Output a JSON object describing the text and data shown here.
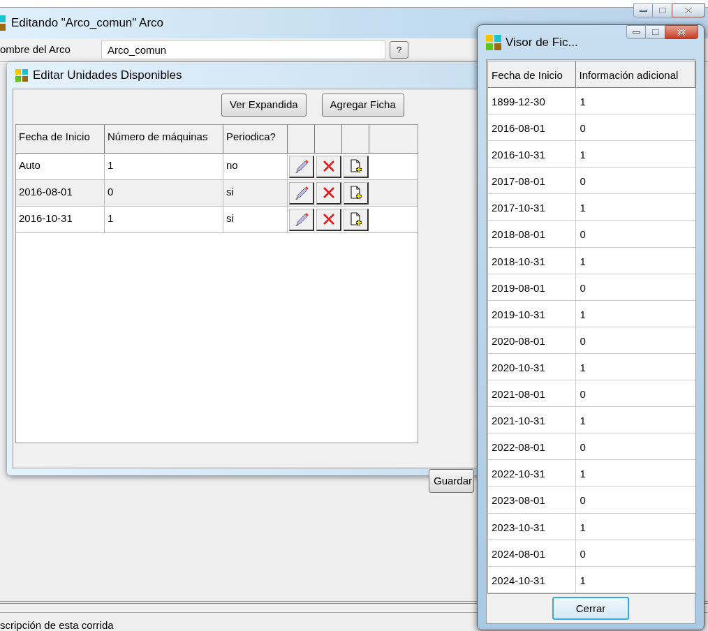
{
  "main_window": {
    "title": "Editando \"Arco_comun\" Arco",
    "name_label": "ombre del Arco",
    "name_value": "Arco_comun",
    "help_button": "?",
    "status_text": "scripción de esta corrida"
  },
  "units_dialog": {
    "title": "Editar Unidades Disponibles",
    "buttons": [
      "Ver Expandida",
      "Agregar Ficha"
    ],
    "columns": [
      "Fecha de Inicio",
      "Número de máquinas",
      "Periodica?"
    ],
    "rows": [
      {
        "fecha": "Auto",
        "maquinas": "1",
        "periodica": "no"
      },
      {
        "fecha": "2016-08-01",
        "maquinas": "0",
        "periodica": "si"
      },
      {
        "fecha": "2016-10-31",
        "maquinas": "1",
        "periodica": "si"
      }
    ],
    "save_button": "Guardar"
  },
  "viewer_window": {
    "title": "Visor de Fic...",
    "columns": [
      "Fecha de Inicio",
      "Información adicional"
    ],
    "rows": [
      [
        "1899-12-30",
        "1"
      ],
      [
        "2016-08-01",
        "0"
      ],
      [
        "2016-10-31",
        "1"
      ],
      [
        "2017-08-01",
        "0"
      ],
      [
        "2017-10-31",
        "1"
      ],
      [
        "2018-08-01",
        "0"
      ],
      [
        "2018-10-31",
        "1"
      ],
      [
        "2019-08-01",
        "0"
      ],
      [
        "2019-10-31",
        "1"
      ],
      [
        "2020-08-01",
        "0"
      ],
      [
        "2020-10-31",
        "1"
      ],
      [
        "2021-08-01",
        "0"
      ],
      [
        "2021-10-31",
        "1"
      ],
      [
        "2022-08-01",
        "0"
      ],
      [
        "2022-10-31",
        "1"
      ],
      [
        "2023-08-01",
        "0"
      ],
      [
        "2023-10-31",
        "1"
      ],
      [
        "2024-08-01",
        "0"
      ],
      [
        "2024-10-31",
        "1"
      ]
    ],
    "close_button": "Cerrar"
  }
}
